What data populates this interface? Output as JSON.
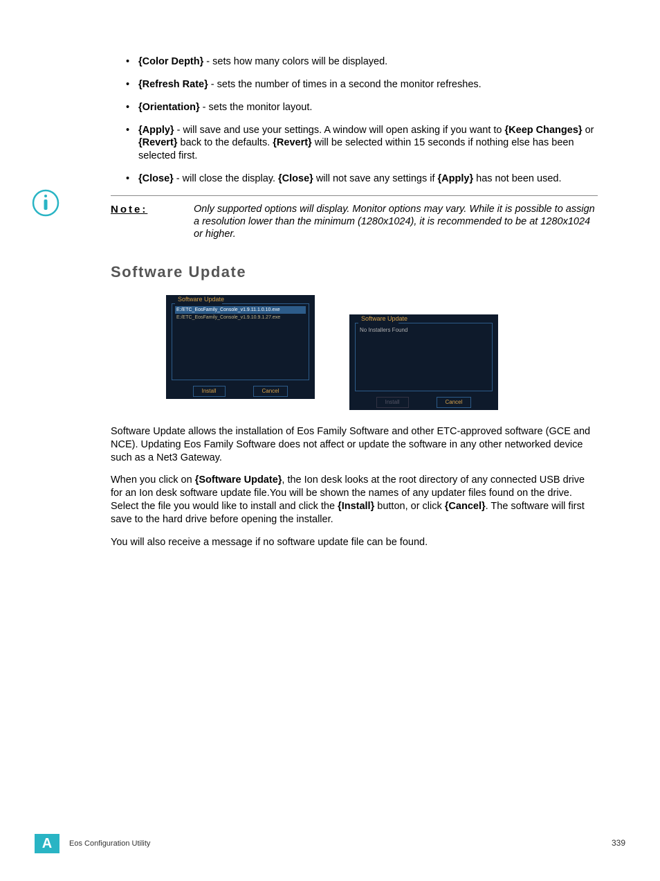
{
  "bullets": {
    "color_depth": {
      "name": "{Color Depth}",
      "desc": " - sets how many colors will be displayed."
    },
    "refresh_rate": {
      "name": "{Refresh Rate}",
      "desc": " - sets the number of times in a second the monitor refreshes."
    },
    "orientation": {
      "name": "{Orientation}",
      "desc": " - sets the monitor layout."
    },
    "apply": {
      "name": "{Apply}",
      "t1": " - will save and use your settings. A window will open asking if you want to ",
      "keep": "{Keep Changes}",
      "t2": " or ",
      "revert1": "{Revert}",
      "t3": " back to the defaults. ",
      "revert2": "{Revert}",
      "t4": " will be selected within 15 seconds if nothing else has been selected first."
    },
    "close": {
      "name": "{Close}",
      "t1": " - will close the display. ",
      "close2": "{Close}",
      "t2": " will not save any settings if ",
      "apply2": "{Apply}",
      "t3": " has not been used."
    }
  },
  "note": {
    "label": "Note:",
    "text": "Only supported options will display. Monitor options may vary. While it is possible to assign a resolution lower than the minimum (1280x1024), it is recommended to be at 1280x1024 or higher."
  },
  "section": {
    "heading": "Software Update"
  },
  "panel1": {
    "title": "Software Update",
    "file1": "E:/ETC_EosFamily_Console_v1.9.11.1.0.10.exe",
    "file2": "E:/ETC_EosFamily_Console_v1.9.10.9.1.27.exe",
    "install": "Install",
    "cancel": "Cancel"
  },
  "panel2": {
    "title": "Software Update",
    "msg": "No Installers Found",
    "install": "Install",
    "cancel": "Cancel"
  },
  "body": {
    "p1": "Software Update allows the installation of Eos Family Software and other ETC-approved software (GCE and NCE). Updating Eos Family Software does not affect or update the software in any other networked device such as a Net3 Gateway.",
    "p2a": "When you click on ",
    "p2_su": "{Software Update}",
    "p2b": ", the Ion desk looks at the root directory of any connected USB drive for an Ion desk software update file.You will be shown the names of any updater files found on the drive. Select the file you would like to install and click the ",
    "p2_install": "{Install}",
    "p2c": " button, or click ",
    "p2_cancel": "{Cancel}",
    "p2d": ". The software will first save to the hard drive before opening the installer.",
    "p3": "You will also receive a message if no software update file can be found."
  },
  "footer": {
    "badge": "A",
    "text": "Eos Configuration Utility",
    "page": "339"
  }
}
